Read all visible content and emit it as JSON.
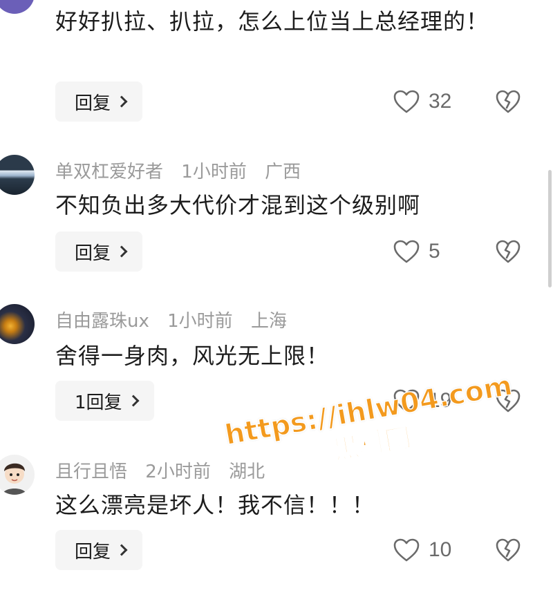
{
  "comments": [
    {
      "username": "",
      "time": "",
      "location": "",
      "text": "好好扒拉、扒拉，怎么上位当上总经理的！",
      "reply_label": "回复",
      "likes": "32"
    },
    {
      "username": "单双杠爱好者",
      "time": "1小时前",
      "location": "广西",
      "text": "不知负出多大代价才混到这个级别啊",
      "reply_label": "回复",
      "likes": "5"
    },
    {
      "username": "自由露珠ux",
      "time": "1小时前",
      "location": "上海",
      "text": "舍得一身肉，风光无上限！",
      "reply_label": "1回复",
      "likes": "19"
    },
    {
      "username": "且行且悟",
      "time": "2小时前",
      "location": "湖北",
      "text": "这么漂亮是坏人！我不信！！！",
      "reply_label": "回复",
      "likes": "10"
    }
  ],
  "watermark": {
    "url": "https://ihlw04.com",
    "name": "黑料网",
    "color": "#f39a1e"
  }
}
